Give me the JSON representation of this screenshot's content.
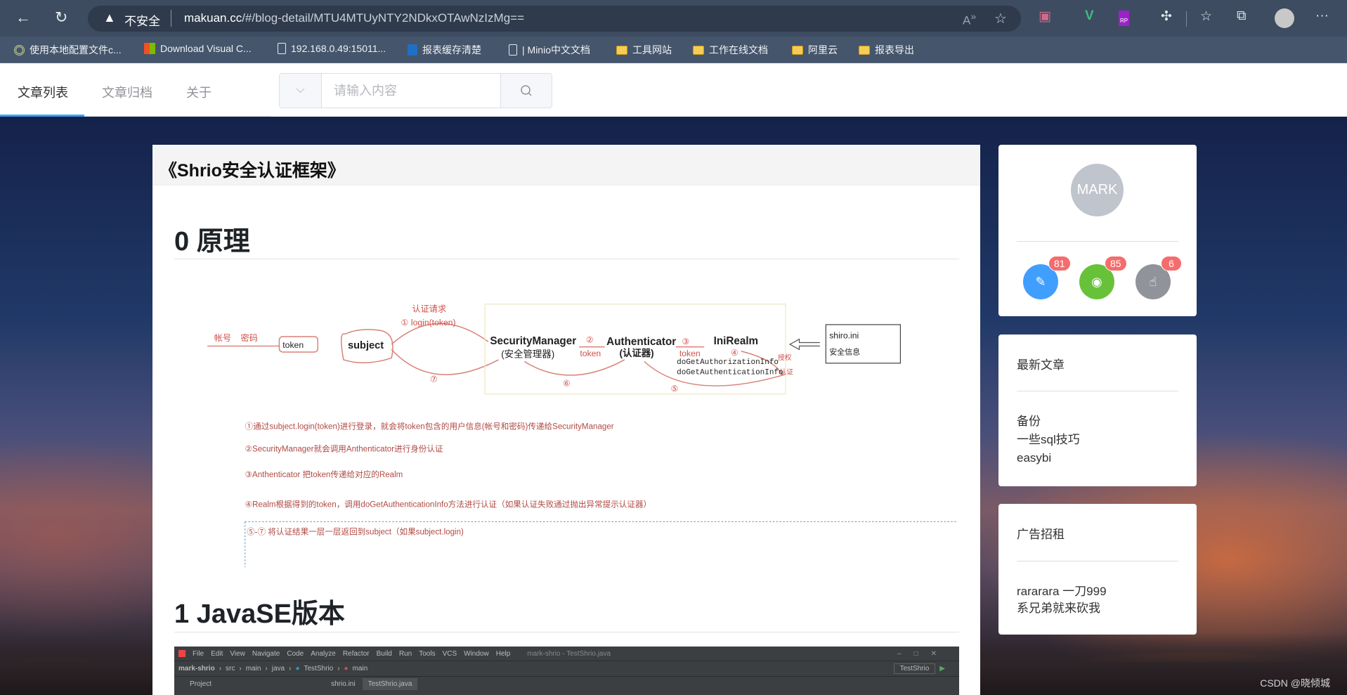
{
  "browser": {
    "security_label": "不安全",
    "url_host": "makuan.cc",
    "url_path": "/#/blog-detail/MTU4MTUyNTY2NDkxOTAwNzIzMg==",
    "bookmarks": [
      {
        "label": "使用本地配置文件c...",
        "icon": "profile-icon"
      },
      {
        "label": "Download Visual C...",
        "icon": "microsoft-icon"
      },
      {
        "label": "192.168.0.49:15011...",
        "icon": "page-icon"
      },
      {
        "label": "报表缓存清楚",
        "icon": "report-icon"
      },
      {
        "label": "| Minio中文文档",
        "icon": "page-icon"
      },
      {
        "label": "工具网站",
        "icon": "folder-icon"
      },
      {
        "label": "工作在线文档",
        "icon": "folder-icon"
      },
      {
        "label": "阿里云",
        "icon": "folder-icon"
      },
      {
        "label": "报表导出",
        "icon": "folder-icon"
      }
    ]
  },
  "nav": {
    "items": [
      "文章列表",
      "文章归档",
      "关于"
    ],
    "active": 0,
    "search_placeholder": "请输入内容"
  },
  "article": {
    "title": "《Shrio安全认证框架》",
    "sections": [
      "0 原理",
      "1 JavaSE版本"
    ],
    "diagram": {
      "account": "帐号",
      "password": "密码",
      "token_box": "token",
      "subject": "subject",
      "request": "认证请求",
      "step1": "① login(token)",
      "security_manager": "SecurityManager",
      "security_manager_cn": "(安全管理器)",
      "step2": "②",
      "token2": "token",
      "authenticator": "Authenticator",
      "authenticator_cn": "(认证器)",
      "step3": "③",
      "token3": "token",
      "realm": "IniRealm",
      "step4": "④",
      "authz": "授权",
      "authc": "认证",
      "method1": "doGetAuthorizationInfo",
      "method2": "doGetAuthenticationInfo",
      "step5": "⑤",
      "step6": "⑥",
      "step7": "⑦",
      "ini_file": "shiro.ini",
      "ini_desc": "安全信息",
      "notes": [
        "①通过subject.login(token)进行登录，就会将token包含的用户信息(帐号和密码)传递给SecurityManager",
        "②SecurityManager就会调用Anthenticator进行身份认证",
        "③Anthenticator 把token传递给对应的Realm",
        "④Realm根据得到的token，调用doGetAuthenticationInfo方法进行认证（如果认证失败通过抛出异常提示认证器）",
        "⑤-⑦ 将认证结果一层一层返回到subject（如果subject.login)"
      ]
    },
    "ide": {
      "menu": [
        "File",
        "Edit",
        "View",
        "Navigate",
        "Code",
        "Analyze",
        "Refactor",
        "Build",
        "Run",
        "Tools",
        "VCS",
        "Window",
        "Help"
      ],
      "window_title": "mark-shrio - TestShrio.java",
      "breadcrumbs": [
        "mark-shrio",
        "src",
        "main",
        "java",
        "TestShrio",
        "main"
      ],
      "run_config": "TestShrio",
      "project_label": "Project",
      "tabs": [
        "shrio.ini",
        "TestShrio.java"
      ]
    }
  },
  "profile": {
    "avatar_text": "MARK",
    "stats": [
      {
        "icon": "edit-icon",
        "count": "81",
        "color": "#409eff"
      },
      {
        "icon": "eye-icon",
        "count": "85",
        "color": "#67c23a"
      },
      {
        "icon": "hand-pointer-icon",
        "count": "6",
        "color": "#909399"
      }
    ]
  },
  "latest": {
    "title": "最新文章",
    "items": [
      "备份",
      "一些sql技巧",
      "easybi"
    ]
  },
  "ads": {
    "title": "广告招租",
    "lines": [
      "rararara 一刀999",
      "系兄弟就来砍我"
    ]
  },
  "watermark": "CSDN @晓倾城"
}
